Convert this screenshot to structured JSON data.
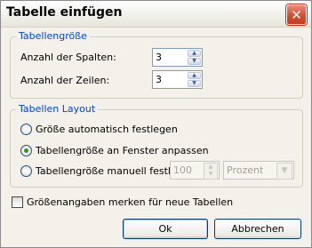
{
  "window": {
    "title": "Tabelle einfügen"
  },
  "size_group": {
    "title": "Tabellengröße",
    "columns_label": "Anzahl der Spalten:",
    "columns_value": "3",
    "rows_label": "Anzahl der Zeilen:",
    "rows_value": "3"
  },
  "layout_group": {
    "title": "Tabellen Layout",
    "options": [
      {
        "label": "Größe automatisch festlegen",
        "checked": false
      },
      {
        "label": "Tabellengröße an Fenster anpassen",
        "checked": true
      },
      {
        "label": "Tabellengröße manuell festl",
        "checked": false
      }
    ],
    "manual_value": "100",
    "unit_value": "Prozent"
  },
  "remember_checkbox": {
    "label": "Größenangaben merken für neue Tabellen",
    "checked": false
  },
  "buttons": {
    "ok": "Ok",
    "cancel": "Abbrechen"
  }
}
